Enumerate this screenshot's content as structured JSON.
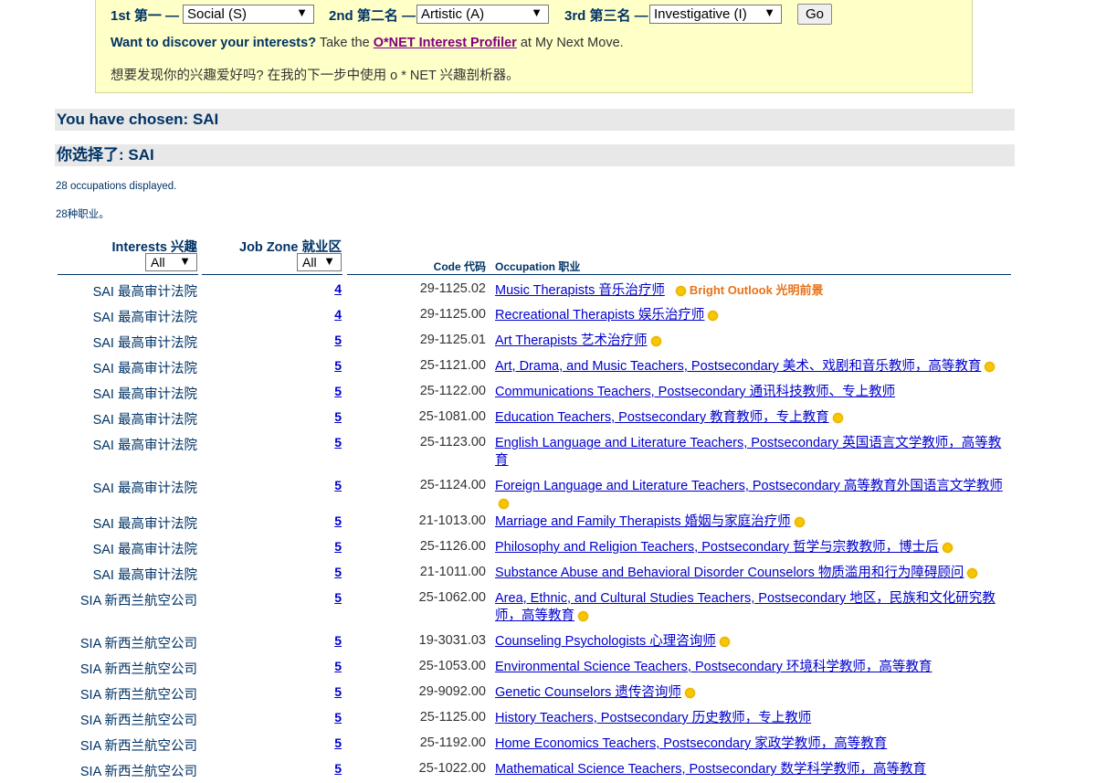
{
  "chooser": {
    "first": {
      "label": "1st 第一 —",
      "value": "Social (S)"
    },
    "second": {
      "label": "2nd 第二名 —",
      "value": "Artistic (A)"
    },
    "third": {
      "label": "3rd 第三名 —",
      "value": "Investigative (I)"
    },
    "go_label": "Go",
    "promo_bold": "Want to discover your interests?",
    "promo_pre": "Take the",
    "promo_link": "O*NET Interest Profiler",
    "promo_post": "at My Next Move.",
    "promo_zh": "想要发现你的兴趣爱好吗? 在我的下一步中使用 o * NET 兴趣剖析器。"
  },
  "chosen_en": "You have chosen: SAI",
  "chosen_zh": "你选择了: SAI",
  "count_en": "28 occupations displayed.",
  "count_zh": "28种职业。",
  "table": {
    "col_interests": "Interests 兴趣",
    "col_zone": "Job Zone 就业区",
    "col_code": "Code 代码",
    "col_occupation": "Occupation 职业",
    "interests_filter": "All",
    "zone_filter": "All",
    "bright_outlook_label": "Bright Outlook 光明前景",
    "rows": [
      {
        "interest": "SAI 最高审计法院",
        "zone": "4",
        "code": "29-1125.02",
        "occupation": "Music Therapists 音乐治疗师",
        "bright": true
      },
      {
        "interest": "SAI 最高审计法院",
        "zone": "4",
        "code": "29-1125.00",
        "occupation": "Recreational Therapists 娱乐治疗师",
        "bright": true
      },
      {
        "interest": "SAI 最高审计法院",
        "zone": "5",
        "code": "29-1125.01",
        "occupation": "Art Therapists 艺术治疗师",
        "bright": true
      },
      {
        "interest": "SAI 最高审计法院",
        "zone": "5",
        "code": "25-1121.00",
        "occupation": "Art, Drama, and Music Teachers, Postsecondary 美术、戏剧和音乐教师，高等教育",
        "bright": true
      },
      {
        "interest": "SAI 最高审计法院",
        "zone": "5",
        "code": "25-1122.00",
        "occupation": "Communications Teachers, Postsecondary 通讯科技教师、专上教师",
        "bright": false
      },
      {
        "interest": "SAI 最高审计法院",
        "zone": "5",
        "code": "25-1081.00",
        "occupation": "Education Teachers, Postsecondary 教育教师，专上教育",
        "bright": true
      },
      {
        "interest": "SAI 最高审计法院",
        "zone": "5",
        "code": "25-1123.00",
        "occupation": "English Language and Literature Teachers, Postsecondary 英国语言文学教师，高等教育",
        "bright": false
      },
      {
        "interest": "SAI 最高审计法院",
        "zone": "5",
        "code": "25-1124.00",
        "occupation": "Foreign Language and Literature Teachers, Postsecondary 高等教育外国语言文学教师",
        "bright": true
      },
      {
        "interest": "SAI 最高审计法院",
        "zone": "5",
        "code": "21-1013.00",
        "occupation": "Marriage and Family Therapists 婚姻与家庭治疗师",
        "bright": true
      },
      {
        "interest": "SAI 最高审计法院",
        "zone": "5",
        "code": "25-1126.00",
        "occupation": "Philosophy and Religion Teachers, Postsecondary 哲学与宗教教师，博士后",
        "bright": true
      },
      {
        "interest": "SAI 最高审计法院",
        "zone": "5",
        "code": "21-1011.00",
        "occupation": "Substance Abuse and Behavioral Disorder Counselors 物质滥用和行为障碍顾问",
        "bright": true
      },
      {
        "interest": "SIA 新西兰航空公司",
        "zone": "5",
        "code": "25-1062.00",
        "occupation": "Area, Ethnic, and Cultural Studies Teachers, Postsecondary 地区，民族和文化研究教师，高等教育",
        "bright": true
      },
      {
        "interest": "SIA 新西兰航空公司",
        "zone": "5",
        "code": "19-3031.03",
        "occupation": "Counseling Psychologists 心理咨询师",
        "bright": true
      },
      {
        "interest": "SIA 新西兰航空公司",
        "zone": "5",
        "code": "25-1053.00",
        "occupation": "Environmental Science Teachers, Postsecondary 环境科学教师，高等教育",
        "bright": false
      },
      {
        "interest": "SIA 新西兰航空公司",
        "zone": "5",
        "code": "29-9092.00",
        "occupation": "Genetic Counselors 遗传咨询师",
        "bright": true
      },
      {
        "interest": "SIA 新西兰航空公司",
        "zone": "5",
        "code": "25-1125.00",
        "occupation": "History Teachers, Postsecondary 历史教师，专上教师",
        "bright": false
      },
      {
        "interest": "SIA 新西兰航空公司",
        "zone": "5",
        "code": "25-1192.00",
        "occupation": "Home Economics Teachers, Postsecondary 家政学教师，高等教育",
        "bright": false
      },
      {
        "interest": "SIA 新西兰航空公司",
        "zone": "5",
        "code": "25-1022.00",
        "occupation": "Mathematical Science Teachers, Postsecondary 数学科学教师，高等教育",
        "bright": false
      }
    ]
  }
}
